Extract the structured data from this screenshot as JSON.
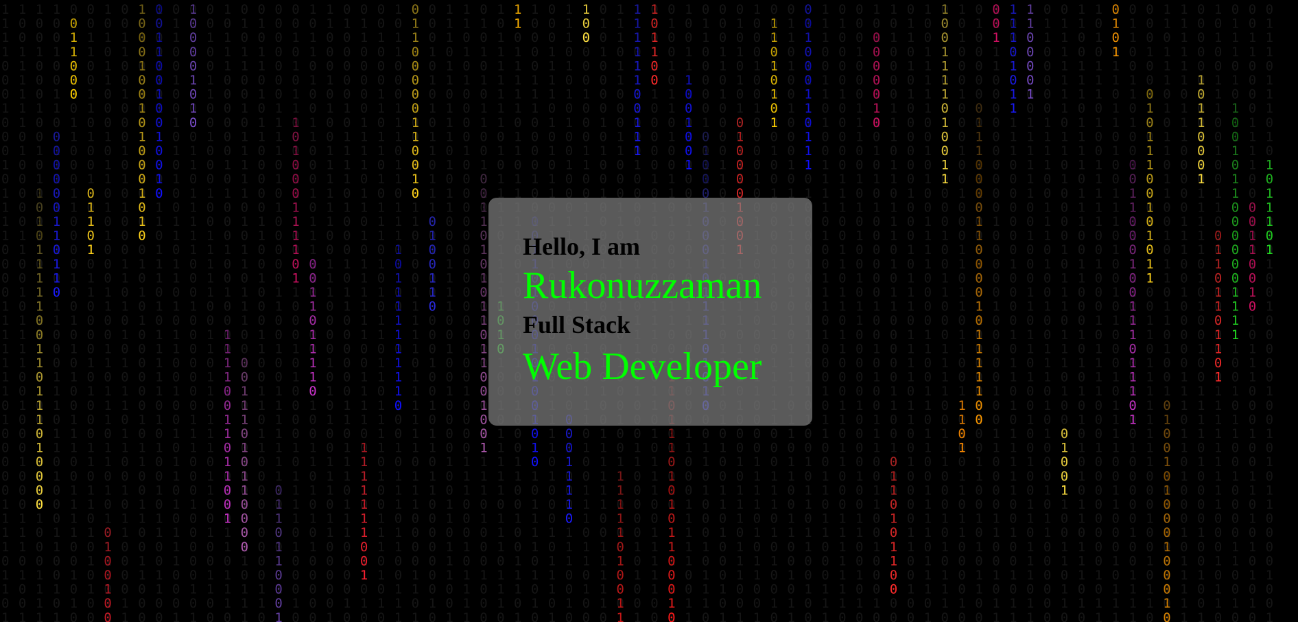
{
  "intro": {
    "greeting": "Hello, I am",
    "name": "Rukonuzzaman",
    "role_prefix": "Full Stack",
    "role": "Web Developer"
  },
  "colors": {
    "background": "#000000",
    "card_background": "#808080",
    "heading_text": "#000000",
    "highlight_text": "#00ff00"
  },
  "binary_rain": {
    "glyphs": [
      "0",
      "1"
    ],
    "palette": [
      "#ffd21a",
      "#ffb300",
      "#1a1aff",
      "#2a2add",
      "#7a4ccc",
      "#ffe040",
      "#22dd22",
      "#ff1a1a",
      "#ff2030",
      "#cc1060",
      "#ff2a2a",
      "#cc33cc",
      "#b05ab0",
      "#ff9a00",
      "#ff8c00",
      "#ffd000",
      "#e03a00",
      "#1010ff"
    ]
  }
}
